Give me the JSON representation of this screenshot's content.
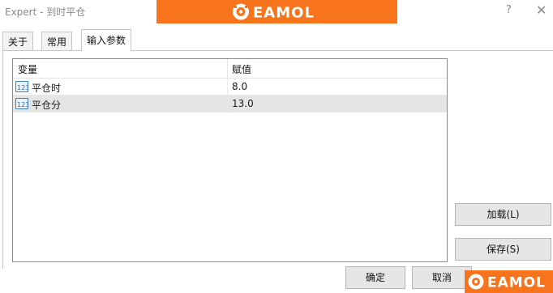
{
  "window": {
    "title": "Expert - 到时平仓",
    "help_label": "?",
    "close_label": "✕"
  },
  "colors": {
    "brand_orange": "#f7731c",
    "selected_row": "#e5e5e5",
    "grid_border": "#8c8c8c"
  },
  "banner": {
    "logo_text": "EAMOL"
  },
  "tabs": [
    {
      "label": "关于"
    },
    {
      "label": "常用"
    },
    {
      "label": "输入参数"
    }
  ],
  "active_tab": "输入参数",
  "grid": {
    "headers": {
      "variable": "变量",
      "value": "赋值"
    },
    "rows": [
      {
        "name": "平仓时",
        "value": "8.0",
        "icon": "int-param-icon"
      },
      {
        "name": "平仓分",
        "value": "13.0",
        "icon": "int-param-icon"
      }
    ],
    "selected_row": 1
  },
  "buttons": {
    "load": "加载(L)",
    "save": "保存(S)",
    "ok": "确定",
    "cancel": "取消"
  },
  "corner_logo": {
    "logo_text": "EAMOL"
  }
}
